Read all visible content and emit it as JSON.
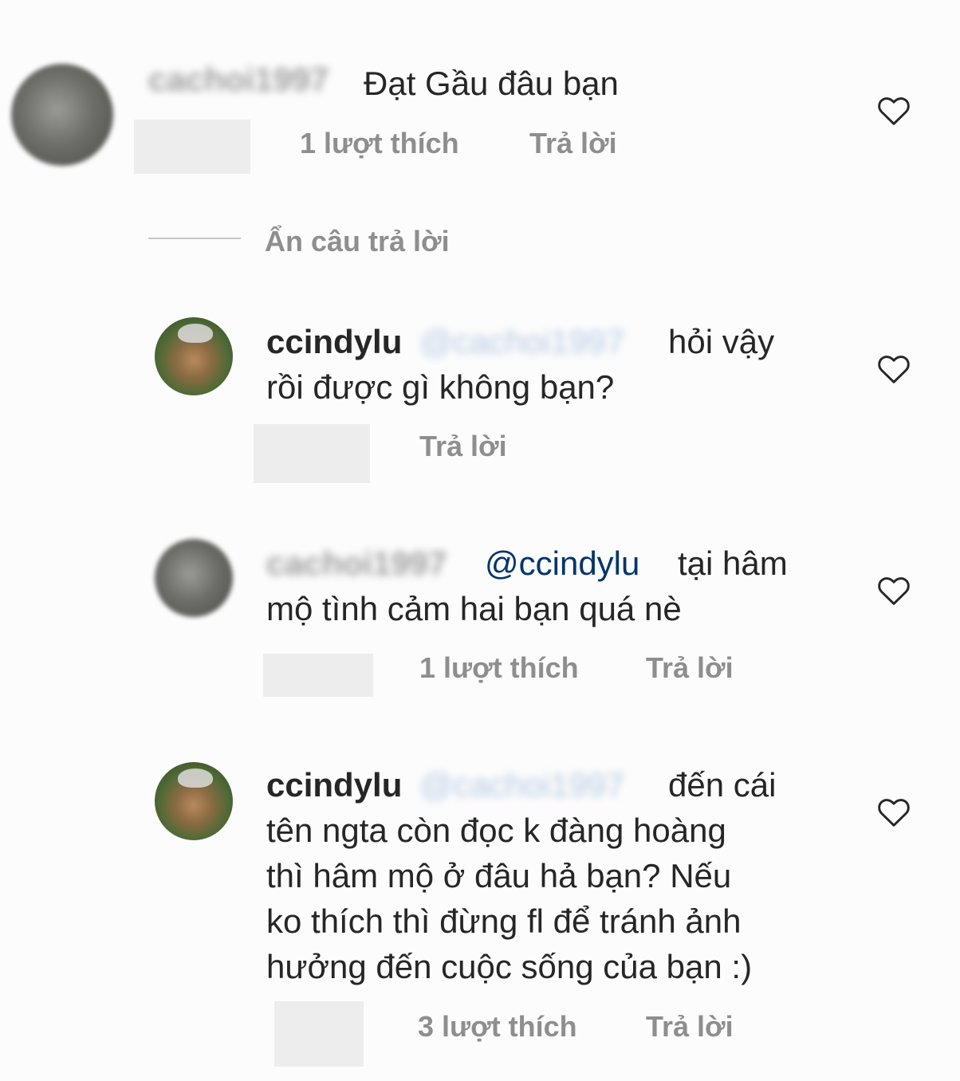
{
  "comment1": {
    "username": "cachoi1997",
    "text": "Đạt Gầu đâu bạn",
    "likes": "1 lượt thích",
    "reply": "Trả lời"
  },
  "hide_replies": "Ẩn câu trả lời",
  "reply1": {
    "username": "ccindylu",
    "mention": "@cachoi1997",
    "text_line1": "hỏi vậy",
    "text_line2": "rồi được gì không bạn?",
    "reply": "Trả lời"
  },
  "reply2": {
    "username": "cachoi1997",
    "mention": "@ccindylu",
    "text_line1": "tại hâm",
    "text_line2": "mộ tình cảm hai bạn quá nè",
    "likes": "1 lượt thích",
    "reply": "Trả lời"
  },
  "reply3": {
    "username": "ccindylu",
    "mention": "@cachoi1997",
    "text_line1": "đến cái",
    "text_line2": "tên ngta còn đọc k đàng hoàng",
    "text_line3": "thì hâm mộ ở đâu hả bạn? Nếu",
    "text_line4": "ko thích thì đừng fl để tránh ảnh",
    "text_line5": "hưởng đến cuộc sống của bạn :)",
    "likes": "3 lượt thích",
    "reply": "Trả lời"
  },
  "colors": {
    "text": "#262626",
    "meta": "#8e8e8e",
    "mention": "#003569",
    "background": "#fcfcfc"
  }
}
